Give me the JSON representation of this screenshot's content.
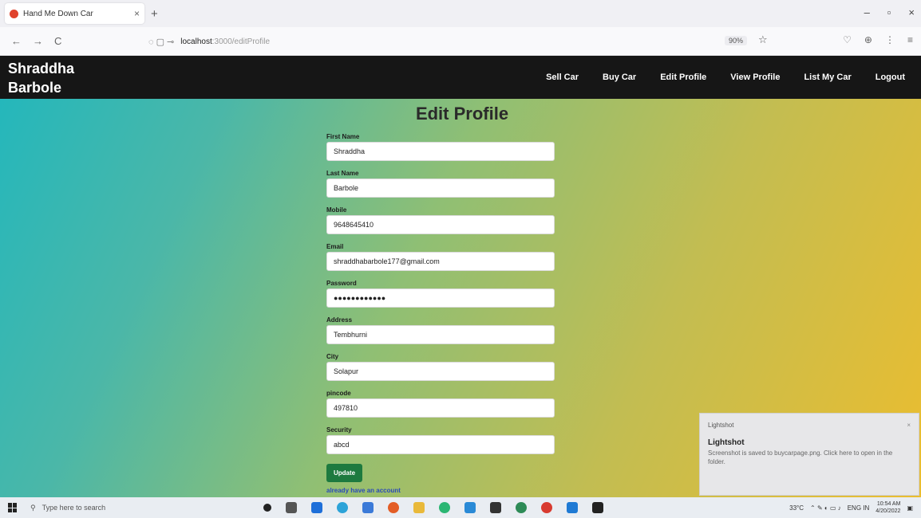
{
  "browser": {
    "tab_title": "Hand Me Down Car",
    "tab_close": "×",
    "new_tab": "+",
    "window_controls": [
      "–",
      "▫",
      "×"
    ],
    "nav": {
      "back": "←",
      "forward": "→",
      "reload": "C"
    },
    "url_host": "localhost",
    "url_path": ":3000/editProfile",
    "zoom": "90%",
    "star": "☆",
    "right_icons": [
      "♡",
      "⊕",
      "⋮",
      "≡"
    ]
  },
  "site": {
    "brand": "Shraddha Barbole",
    "menu": [
      "Sell Car",
      "Buy Car",
      "Edit Profile",
      "View Profile",
      "List My Car",
      "Logout"
    ]
  },
  "form": {
    "title": "Edit Profile",
    "fields": [
      {
        "label": "First Name",
        "value": "Shraddha"
      },
      {
        "label": "Last Name",
        "value": "Barbole"
      },
      {
        "label": "Mobile",
        "value": "9648645410"
      },
      {
        "label": "Email",
        "value": "shraddhabarbole177@gmail.com"
      },
      {
        "label": "Password",
        "value": "●●●●●●●●●●●●"
      },
      {
        "label": "Address",
        "value": "Tembhurni"
      },
      {
        "label": "City",
        "value": "Solapur"
      },
      {
        "label": "pincode",
        "value": "497810"
      },
      {
        "label": "Security",
        "value": "abcd"
      }
    ],
    "button": "Update",
    "link": "already have an account"
  },
  "toast": {
    "app": "Lightshot",
    "close": "×",
    "title": "Lightshot",
    "message": "Screenshot is saved to buycarpage.png. Click here to open in the folder."
  },
  "taskbar": {
    "search_placeholder": "Type here to search",
    "temperature": "33°C",
    "lang": "ENG IN",
    "time": "10:54 AM",
    "date": "4/20/2022"
  },
  "colors": {
    "nav_bg": "#161616",
    "button_bg": "#1d7a3f",
    "gradient_start": "#21b7bd",
    "gradient_end": "#ebbd2f"
  }
}
